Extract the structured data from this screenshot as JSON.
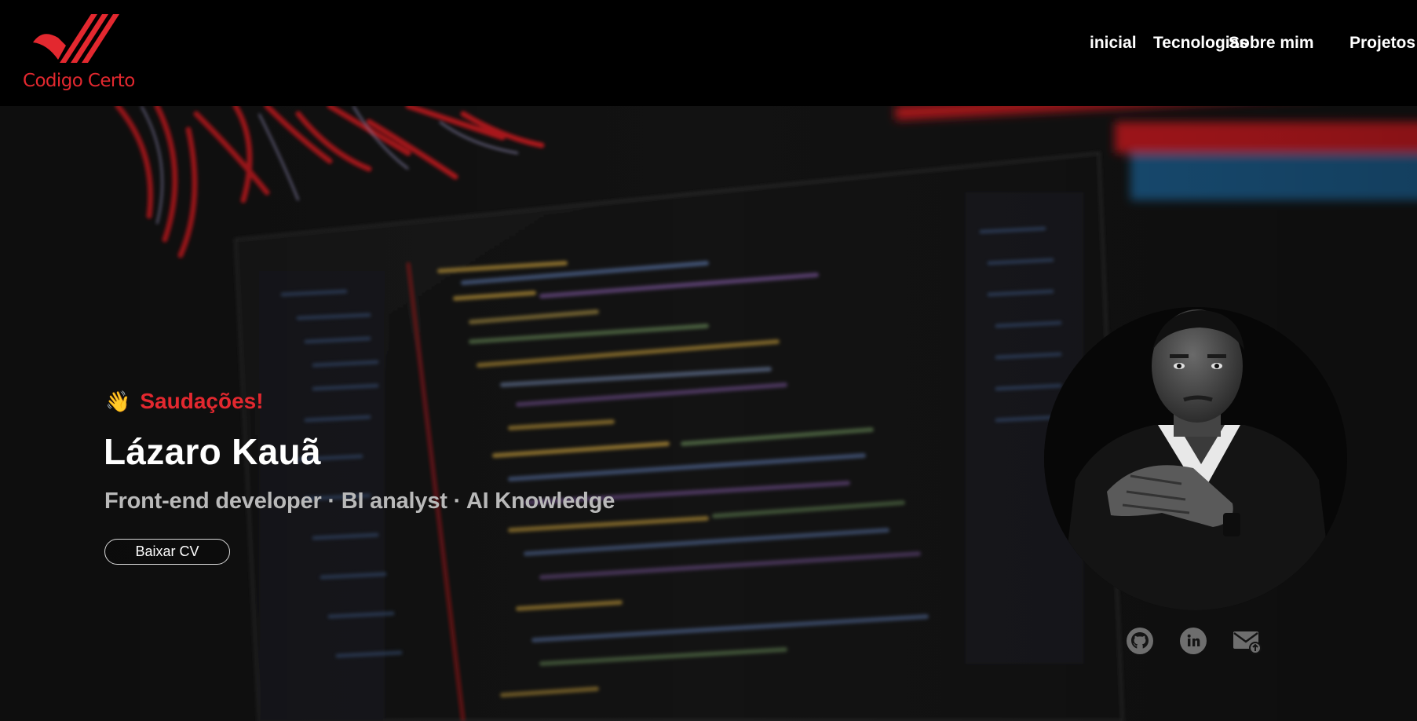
{
  "brand": {
    "logo_text": "Codigo Certo",
    "color": "#e3282f"
  },
  "nav": {
    "items": [
      {
        "label": "inicial"
      },
      {
        "label": "Tecnologias"
      },
      {
        "label": "Sobre mim"
      },
      {
        "label": "Projetos"
      }
    ]
  },
  "hero": {
    "greeting_icon": "waving-hand-icon",
    "greeting": "Saudações!",
    "name": "Lázaro Kauã",
    "role": "Front-end developer · BI analyst · AI Knowledge",
    "cv_button": "Baixar CV",
    "accent_color": "#e3282f"
  },
  "socials": [
    {
      "icon": "github-icon"
    },
    {
      "icon": "linkedin-icon"
    },
    {
      "icon": "email-icon"
    }
  ]
}
